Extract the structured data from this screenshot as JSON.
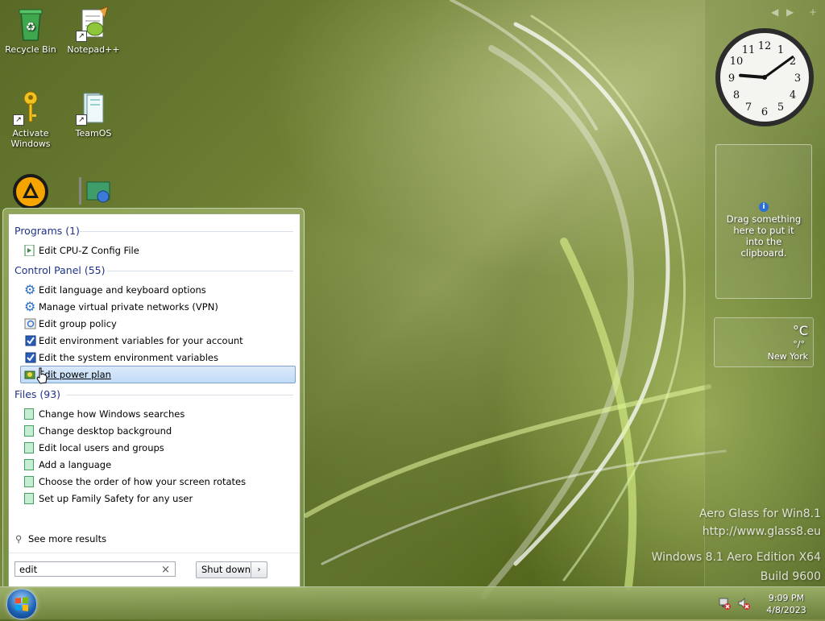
{
  "desktop": {
    "icons": [
      {
        "label": "Recycle Bin",
        "icon": "recycle-bin-icon"
      },
      {
        "label": "Notepad++",
        "icon": "notepad-plus-plus-icon"
      },
      {
        "label": "Activate\nWindows",
        "icon": "key-icon"
      },
      {
        "label": "TeamOS",
        "icon": "teamos-icon"
      },
      {
        "label": "",
        "icon": "aimp-icon"
      },
      {
        "label": "",
        "icon": "network-app-icon"
      }
    ],
    "watermark": {
      "line1": "Aero Glass for Win8.1",
      "line2": "http://www.glass8.eu",
      "line3": "Windows 8.1 Aero Edition X64",
      "line4": "Build 9600"
    }
  },
  "sidebar": {
    "clock": {
      "hour": 9,
      "minute": 9
    },
    "clipboard": {
      "text": "Drag something here to put it into the clipboard."
    },
    "weather": {
      "unit": "°C",
      "range": "°/°",
      "city": "New York"
    }
  },
  "start_menu": {
    "groups": [
      {
        "title": "Programs (1)",
        "items": [
          {
            "label": "Edit CPU-Z Config File",
            "icon": "config-file-icon"
          }
        ]
      },
      {
        "title": "Control Panel (55)",
        "items": [
          {
            "label": "Edit language and keyboard options",
            "icon": "gear-icon"
          },
          {
            "label": "Manage virtual private networks (VPN)",
            "icon": "gear-icon"
          },
          {
            "label": "Edit group policy",
            "icon": "group-policy-icon"
          },
          {
            "label": "Edit environment variables for your account",
            "icon": "system-checkbox-icon"
          },
          {
            "label": "Edit the system environment variables",
            "icon": "system-checkbox-icon"
          },
          {
            "label": "Edit power plan",
            "icon": "power-plan-icon",
            "highlighted": true
          }
        ]
      },
      {
        "title": "Files (93)",
        "items": [
          {
            "label": "Change how Windows searches",
            "icon": "file-icon"
          },
          {
            "label": "Change desktop background",
            "icon": "file-icon"
          },
          {
            "label": "Edit local users and groups",
            "icon": "file-icon"
          },
          {
            "label": "Add a language",
            "icon": "file-icon"
          },
          {
            "label": "Choose the order of how your screen rotates",
            "icon": "file-icon"
          },
          {
            "label": "Set up Family Safety for any user",
            "icon": "file-icon"
          }
        ]
      }
    ],
    "see_more": "See more results",
    "search": {
      "value": "edit",
      "clear": "×"
    },
    "shutdown": {
      "label": "Shut down",
      "arrow": "›"
    }
  },
  "taskbar": {
    "time": "9:09 PM",
    "date": "4/8/2023"
  }
}
